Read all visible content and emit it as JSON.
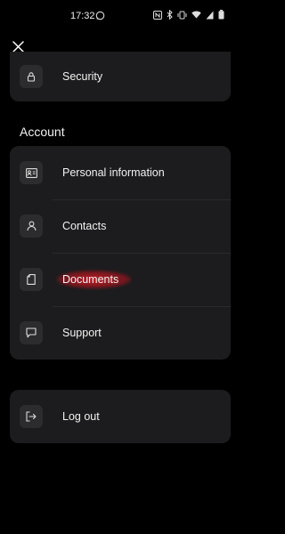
{
  "status_bar": {
    "time": "17:32",
    "icons": [
      "whatsapp-icon",
      "nfc-icon",
      "bluetooth-icon",
      "vibrate-icon",
      "wifi-icon",
      "signal-icon",
      "battery-icon"
    ]
  },
  "header": {
    "close_icon": "close-icon"
  },
  "top_section": {
    "items": [
      {
        "label": "Security",
        "icon": "lock-icon"
      }
    ]
  },
  "account_section": {
    "title": "Account",
    "items": [
      {
        "label": "Personal information",
        "icon": "id-card-icon"
      },
      {
        "label": "Contacts",
        "icon": "person-icon"
      },
      {
        "label": "Documents",
        "icon": "document-icon"
      },
      {
        "label": "Support",
        "icon": "chat-icon"
      }
    ]
  },
  "logout_section": {
    "label": "Log out",
    "icon": "logout-icon"
  },
  "colors": {
    "background": "#000000",
    "card": "#1c1c1e",
    "icon_box": "#2c2c2e",
    "highlight": "#dc1e28"
  }
}
